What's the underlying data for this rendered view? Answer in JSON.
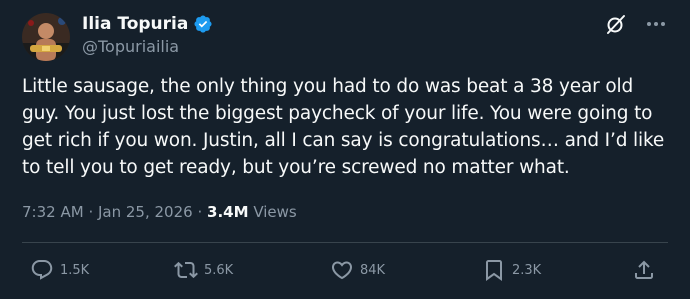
{
  "user": {
    "display_name": "Ilia Topuria",
    "handle": "@Topuriailia"
  },
  "icons": {
    "verified": "verified-badge-icon",
    "grok": "grok-icon",
    "more": "more-options-icon"
  },
  "tweet": {
    "text": "Little sausage, the only thing you had to do was beat a 38 year old guy. You just lost the biggest paycheck of your life. You were going to get rich if you won. Justin, all I can say is congratulations… and I’d like to tell you to get ready, but you’re screwed no matter what."
  },
  "meta": {
    "time": "7:32 AM",
    "separator": "·",
    "date": "Jan 25, 2026",
    "views_count": "3.4M",
    "views_label": "Views"
  },
  "actions": {
    "replies": "1.5K",
    "reposts": "5.6K",
    "likes": "84K",
    "bookmarks": "2.3K"
  },
  "colors": {
    "background": "#15202b",
    "text": "#f7f9f9",
    "secondary": "#8b98a5",
    "verified": "#1d9bf0",
    "divider": "#38444d"
  }
}
